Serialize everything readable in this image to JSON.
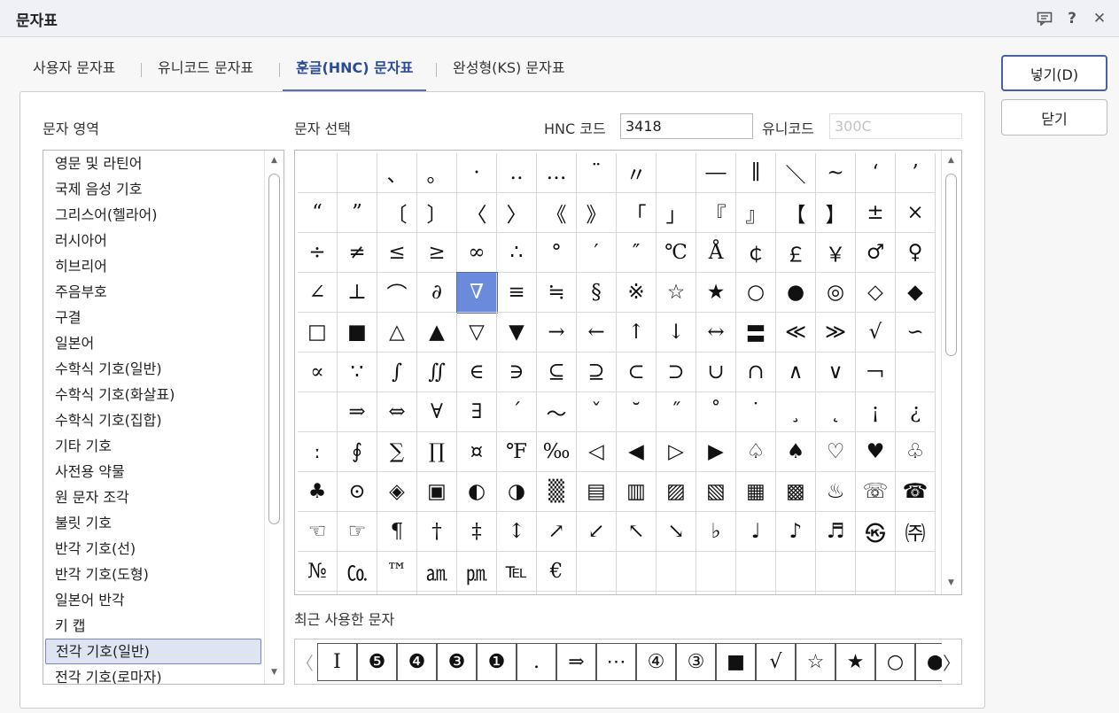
{
  "window": {
    "title": "문자표",
    "icons": [
      "comment-icon",
      "help-icon",
      "close-icon"
    ],
    "help_glyph": "?",
    "close_glyph": "✕"
  },
  "tabs": [
    {
      "label": "사용자 문자표",
      "active": false
    },
    {
      "label": "유니코드 문자표",
      "active": false
    },
    {
      "label": "훈글(HNC) 문자표",
      "active": true
    },
    {
      "label": "완성형(KS) 문자표",
      "active": false
    }
  ],
  "region": {
    "label": "문자 영역",
    "items": [
      "영문 및 라틴어",
      "국제 음성 기호",
      "그리스어(헬라어)",
      "러시아어",
      "히브리어",
      "주음부호",
      "구결",
      "일본어",
      "수학식 기호(일반)",
      "수학식 기호(화살표)",
      "수학식 기호(집합)",
      "기타 기호",
      "사전용 약물",
      "원 문자 조각",
      "불릿 기호",
      "반각 기호(선)",
      "반각 기호(도형)",
      "일본어 반각",
      "키 캡",
      "전각 기호(일반)",
      "전각 기호(로마자)"
    ],
    "selected_index": 19
  },
  "select": {
    "label": "문자 선택",
    "hnc_label": "HNC 코드",
    "hnc_value": "3418",
    "unicode_label": "유니코드",
    "unicode_value": "300C",
    "selected_cell": 52,
    "cells": [
      "",
      "",
      "、",
      "。",
      "·",
      "‥",
      "…",
      "¨",
      "〃",
      "",
      "―",
      "∥",
      "＼",
      "∼",
      "‘",
      "’",
      "“",
      "”",
      "〔",
      "〕",
      "〈",
      "〉",
      "《",
      "》",
      "「",
      "」",
      "『",
      "』",
      "【",
      "】",
      "±",
      "×",
      "÷",
      "≠",
      "≤",
      "≥",
      "∞",
      "∴",
      "°",
      "′",
      "″",
      "℃",
      "Å",
      "￠",
      "￡",
      "￥",
      "♂",
      "♀",
      "∠",
      "⊥",
      "⌒",
      "∂",
      "∇",
      "≡",
      "≒",
      "§",
      "※",
      "☆",
      "★",
      "○",
      "●",
      "◎",
      "◇",
      "◆",
      "□",
      "■",
      "△",
      "▲",
      "▽",
      "▼",
      "→",
      "←",
      "↑",
      "↓",
      "↔",
      "〓",
      "≪",
      "≫",
      "√",
      "∽",
      "∝",
      "∵",
      "∫",
      "∬",
      "∈",
      "∋",
      "⊆",
      "⊇",
      "⊂",
      "⊃",
      "∪",
      "∩",
      "∧",
      "∨",
      "￢",
      "",
      "",
      "⇒",
      "⇔",
      "∀",
      "∃",
      "´",
      "～",
      "ˇ",
      "˘",
      "˝",
      "˚",
      "˙",
      "¸",
      "˛",
      "¡",
      "¿",
      "ː",
      "∮",
      "∑",
      "∏",
      "¤",
      "℉",
      "‰",
      "◁",
      "◀",
      "▷",
      "▶",
      "♤",
      "♠",
      "♡",
      "♥",
      "♧",
      "♣",
      "⊙",
      "◈",
      "▣",
      "◐",
      "◑",
      "▒",
      "▤",
      "▥",
      "▨",
      "▧",
      "▦",
      "▩",
      "♨",
      "☏",
      "☎",
      "☜",
      "☞",
      "¶",
      "†",
      "‡",
      "↕",
      "↗",
      "↙",
      "↖",
      "↘",
      "♭",
      "♩",
      "♪",
      "♬",
      "㉿",
      "㈜",
      "№",
      "㏇",
      "™",
      "㏂",
      "㏘",
      "℡",
      "€",
      "",
      "",
      "",
      "",
      "",
      "",
      "",
      "",
      "",
      "",
      "",
      "",
      "",
      "",
      "",
      "",
      "",
      "",
      "",
      "",
      "",
      "",
      "",
      "",
      ""
    ]
  },
  "recent": {
    "label": "최근 사용한 문자",
    "left_arrow": "〈",
    "right_arrow": "〉",
    "chars": [
      "I",
      "❺",
      "❹",
      "❸",
      "❶",
      ".",
      "⇒",
      "⋯",
      "④",
      "③",
      "■",
      "√",
      "☆",
      "★",
      "○",
      "●"
    ]
  },
  "buttons": {
    "insert": "넣기(D)",
    "close": "닫기"
  }
}
